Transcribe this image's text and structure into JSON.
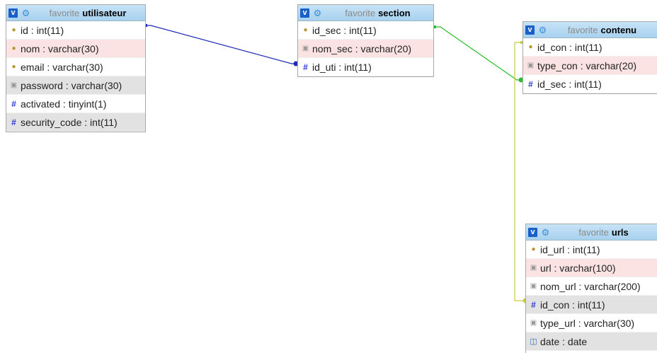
{
  "colors": {
    "header_gradient": [
      "#c7e3f7",
      "#a8d1ee"
    ],
    "toggle": "#1a5fc7",
    "gear": "#3a8fd6",
    "pk_row": "#fbe3e3",
    "idx_row": "#e2e2e2",
    "link_user_section": "#1c2bb8",
    "link_section_contenu": "#2bbf2b",
    "link_contenu_urls": "#c9c94a"
  },
  "toggle_glyph": "v",
  "tables": {
    "utilisateur": {
      "prefix": "favorite",
      "name": "utilisateur",
      "fields": [
        {
          "text": "id : int(11)",
          "icon": "key-icon"
        },
        {
          "text": "nom : varchar(30)",
          "icon": "key-icon"
        },
        {
          "text": "email : varchar(30)",
          "icon": "key-icon"
        },
        {
          "text": "password : varchar(30)",
          "icon": "index-icon"
        },
        {
          "text": "activated : tinyint(1)",
          "icon": "numeric-icon"
        },
        {
          "text": "security_code : int(11)",
          "icon": "numeric-icon"
        }
      ]
    },
    "section": {
      "prefix": "favorite",
      "name": "section",
      "fields": [
        {
          "text": "id_sec : int(11)",
          "icon": "key-icon"
        },
        {
          "text": "nom_sec : varchar(20)",
          "icon": "index-icon"
        },
        {
          "text": "id_uti : int(11)",
          "icon": "numeric-icon"
        }
      ]
    },
    "contenu": {
      "prefix": "favorite",
      "name": "contenu",
      "fields": [
        {
          "text": "id_con : int(11)",
          "icon": "key-icon"
        },
        {
          "text": "type_con : varchar(20)",
          "icon": "index-icon"
        },
        {
          "text": "id_sec : int(11)",
          "icon": "numeric-icon"
        }
      ]
    },
    "urls": {
      "prefix": "favorite",
      "name": "urls",
      "fields": [
        {
          "text": "id_url : int(11)",
          "icon": "key-icon"
        },
        {
          "text": "url : varchar(100)",
          "icon": "index-icon"
        },
        {
          "text": "nom_url : varchar(200)",
          "icon": "index-icon"
        },
        {
          "text": "id_con : int(11)",
          "icon": "numeric-icon"
        },
        {
          "text": "type_url : varchar(30)",
          "icon": "index-icon"
        },
        {
          "text": "date : date",
          "icon": "date-icon"
        }
      ]
    }
  }
}
